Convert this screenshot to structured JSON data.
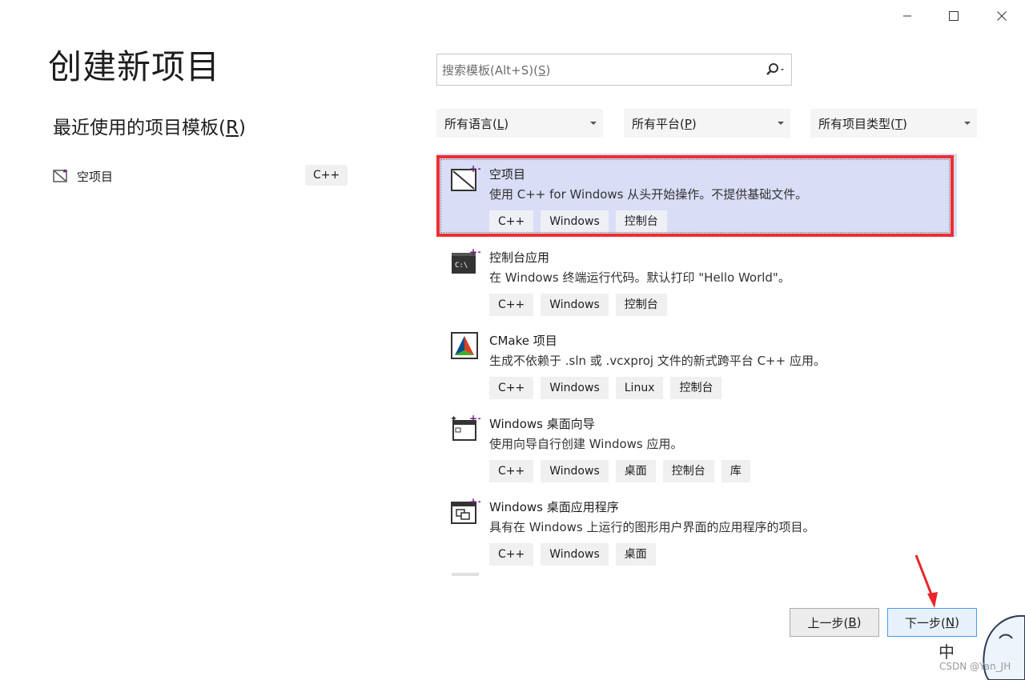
{
  "window": {
    "minimize_icon": "minimize-icon",
    "maximize_icon": "maximize-icon",
    "close_icon": "close-icon"
  },
  "page_title": "创建新项目",
  "recent": {
    "title": "最近使用的项目模板(",
    "title_key": "R",
    "title_end": ")",
    "items": [
      {
        "label": "空项目",
        "tag": "C++",
        "icon": "empty-project-icon"
      }
    ]
  },
  "search": {
    "placeholder_prefix": "搜索模板(Alt+S)(",
    "placeholder_key": "S",
    "placeholder_suffix": ")",
    "icon": "search-icon"
  },
  "filters": [
    {
      "label": "所有语言(",
      "key": "L",
      "end": ")"
    },
    {
      "label": "所有平台(",
      "key": "P",
      "end": ")"
    },
    {
      "label": "所有项目类型(",
      "key": "T",
      "end": ")"
    }
  ],
  "templates": [
    {
      "name": "空项目",
      "desc": "使用 C++ for Windows 从头开始操作。不提供基础文件。",
      "tags": [
        "C++",
        "Windows",
        "控制台"
      ],
      "icon": "empty-project-icon",
      "selected": true
    },
    {
      "name": "控制台应用",
      "desc": "在 Windows 终端运行代码。默认打印 \"Hello World\"。",
      "tags": [
        "C++",
        "Windows",
        "控制台"
      ],
      "icon": "console-app-icon"
    },
    {
      "name": "CMake 项目",
      "desc": "生成不依赖于 .sln 或 .vcxproj 文件的新式跨平台 C++ 应用。",
      "tags": [
        "C++",
        "Windows",
        "Linux",
        "控制台"
      ],
      "icon": "cmake-icon"
    },
    {
      "name": "Windows 桌面向导",
      "desc": "使用向导自行创建 Windows 应用。",
      "tags": [
        "C++",
        "Windows",
        "桌面",
        "控制台",
        "库"
      ],
      "icon": "desktop-wizard-icon"
    },
    {
      "name": "Windows 桌面应用程序",
      "desc": "具有在 Windows 上运行的图形用户界面的应用程序的项目。",
      "tags": [
        "C++",
        "Windows",
        "桌面"
      ],
      "icon": "desktop-app-icon"
    }
  ],
  "buttons": {
    "back": {
      "label": "上一步(",
      "key": "B",
      "end": ")"
    },
    "next": {
      "label": "下一步(",
      "key": "N",
      "end": ")"
    }
  },
  "watermark": "CSDN @Yan_JH",
  "colors": {
    "selection_bg": "#d9def6",
    "highlight_border": "#ee2e31",
    "tag_bg": "#f0f0f0",
    "primary_border": "#4c9be8"
  }
}
